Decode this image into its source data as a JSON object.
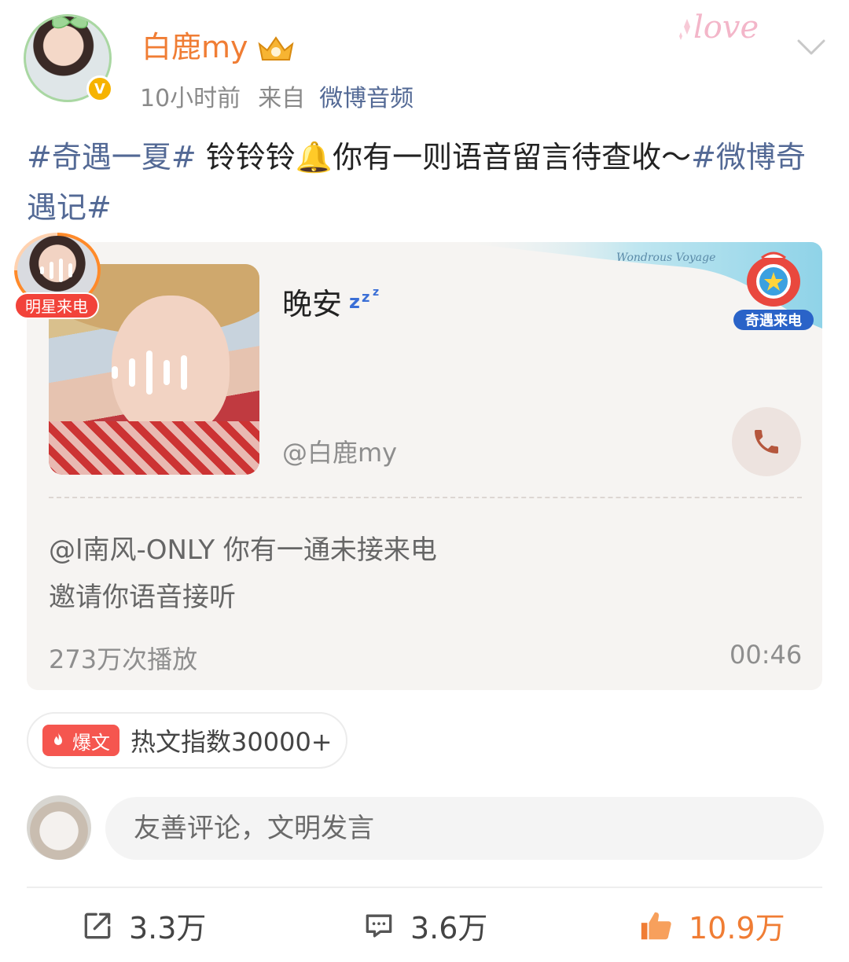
{
  "header": {
    "username": "白鹿my",
    "time": "10小时前",
    "from_label": "来自",
    "source": "微博音频",
    "decoration_text": "love"
  },
  "post": {
    "tag1": "#奇遇一夏#",
    "body": " 铃铃铃🔔你有一则语音留言待查收～",
    "tag2": "#微博奇遇记#"
  },
  "card": {
    "title": "晚安",
    "at_user": "@白鹿my",
    "message_line1": "@l南风-ONLY 你有一通未接来电",
    "message_line2": "邀请你语音接听",
    "plays": "273万次播放",
    "duration": "00:46",
    "mascot_label": "奇遇来电",
    "sea_text": "Wondrous Voyage"
  },
  "star_call": {
    "label": "明星来电"
  },
  "hot": {
    "pill": "爆文",
    "text": "热文指数30000+"
  },
  "comment": {
    "placeholder": "友善评论，文明发言"
  },
  "actions": {
    "share_count": "3.3万",
    "comment_count": "3.6万",
    "like_count": "10.9万"
  },
  "colors": {
    "accent": "#f07d34",
    "link": "#536995",
    "badge_red": "#f2433a"
  }
}
